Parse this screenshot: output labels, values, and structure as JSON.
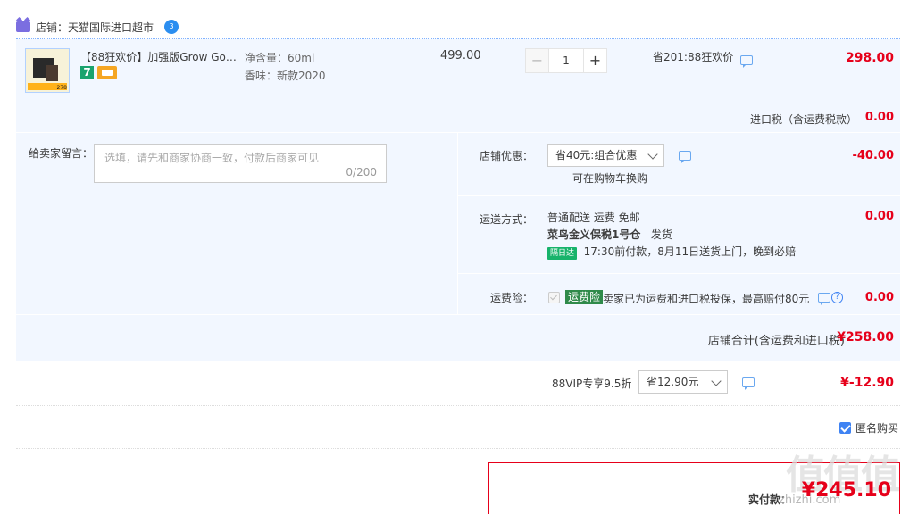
{
  "store": {
    "label": "店铺：天猫国际进口超市",
    "ww_badge": "3"
  },
  "item": {
    "title": "【88狂欢价】加强版Grow Gor...",
    "badge": "7",
    "thumb_price": "278",
    "sku_volume": "净含量：60ml",
    "sku_scent": "香味：新款2020",
    "unit_price": "499.00",
    "quantity": "1",
    "minus": "−",
    "plus": "+",
    "save_note": "省201:88狂欢价",
    "total": "298.00"
  },
  "tax": {
    "label": "进口税（含运费税款）",
    "value": "0.00"
  },
  "message": {
    "label": "给卖家留言：",
    "placeholder": "选填，请先和商家协商一致，付款后商家可见",
    "counter": "0/200"
  },
  "coupon": {
    "label": "店铺优惠：",
    "selected": "省40元:组合优惠",
    "hint": "可在购物车换购",
    "value": "-40.00"
  },
  "shipping": {
    "label": "运送方式：",
    "method": "普通配送 运费 免邮",
    "warehouse": "菜鸟金义保税1号仓",
    "dispatch": "发货",
    "tag": "隔日达",
    "promise": "17:30前付款，8月11日送货上门，晚到必赔",
    "value": "0.00"
  },
  "insurance": {
    "label": "运费险：",
    "badge": "运费险",
    "desc": "卖家已为运费和进口税投保，最高赔付80元",
    "help": "?",
    "value": "0.00"
  },
  "shop_total": {
    "label": "店铺合计(含运费和进口税)",
    "value": "¥258.00"
  },
  "vip": {
    "label": "88VIP专享9.5折",
    "selected": "省12.90元",
    "value": "¥-12.90"
  },
  "anonymous": {
    "label": "匿名购买",
    "checked": true
  },
  "payment": {
    "label": "实付款：",
    "value": "¥245.10"
  },
  "watermark": {
    "main": "值值值",
    "site": "zhizhi.com"
  },
  "colors": {
    "price_red": "#e6001a",
    "panel_blue": "#f2f7ff",
    "accent_blue": "#3f83f3"
  }
}
